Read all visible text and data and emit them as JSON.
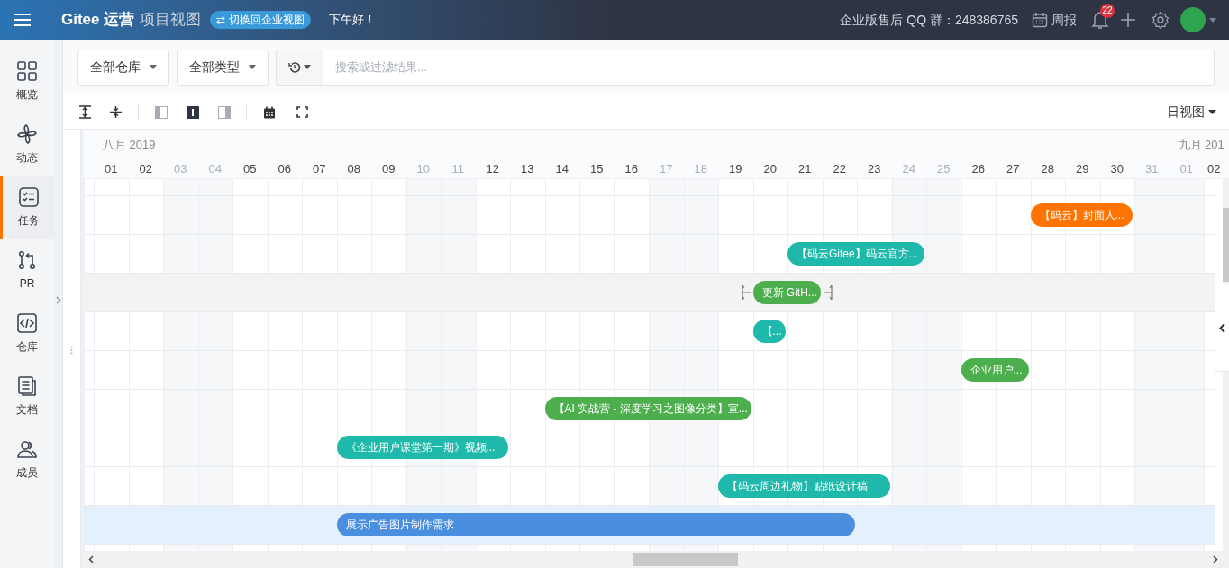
{
  "topbar": {
    "brand": "Gitee 运营",
    "view": "项目视图",
    "switch_label": "⇄ 切换回企业视图",
    "greeting": "下午好！",
    "support": "企业版售后 QQ 群：248386765",
    "report": "周报",
    "notification_count": "22"
  },
  "sidebar": {
    "items": [
      {
        "label": "概览",
        "kind": "overview",
        "selected": false
      },
      {
        "label": "动态",
        "kind": "activity",
        "selected": false
      },
      {
        "label": "任务",
        "kind": "task",
        "selected": true
      },
      {
        "label": "PR",
        "kind": "pr",
        "selected": false
      },
      {
        "label": "仓库",
        "kind": "repo",
        "selected": false
      },
      {
        "label": "文档",
        "kind": "doc",
        "selected": false
      },
      {
        "label": "成员",
        "kind": "member",
        "selected": false
      }
    ]
  },
  "filters": {
    "repo": "全部仓库",
    "type": "全部类型",
    "search_placeholder": "搜索或过滤结果..."
  },
  "toolbar": {
    "layouts": [
      {
        "selected": false
      },
      {
        "selected": true
      },
      {
        "selected": false
      }
    ],
    "view": "日视图"
  },
  "gantt": {
    "months": [
      {
        "label": "八月 2019"
      },
      {
        "label": "九月 201"
      }
    ],
    "days": [
      {
        "label": "01",
        "weekend": false
      },
      {
        "label": "02",
        "weekend": false
      },
      {
        "label": "03",
        "weekend": true
      },
      {
        "label": "04",
        "weekend": true
      },
      {
        "label": "05",
        "weekend": false
      },
      {
        "label": "06",
        "weekend": false
      },
      {
        "label": "07",
        "weekend": false
      },
      {
        "label": "08",
        "weekend": false
      },
      {
        "label": "09",
        "weekend": false
      },
      {
        "label": "10",
        "weekend": true
      },
      {
        "label": "11",
        "weekend": true
      },
      {
        "label": "12",
        "weekend": false
      },
      {
        "label": "13",
        "weekend": false
      },
      {
        "label": "14",
        "weekend": false
      },
      {
        "label": "15",
        "weekend": false
      },
      {
        "label": "16",
        "weekend": false
      },
      {
        "label": "17",
        "weekend": true
      },
      {
        "label": "18",
        "weekend": true
      },
      {
        "label": "19",
        "weekend": false
      },
      {
        "label": "20",
        "weekend": false
      },
      {
        "label": "21",
        "weekend": false
      },
      {
        "label": "22",
        "weekend": false
      },
      {
        "label": "23",
        "weekend": false
      },
      {
        "label": "24",
        "weekend": true
      },
      {
        "label": "25",
        "weekend": true
      },
      {
        "label": "26",
        "weekend": false
      },
      {
        "label": "27",
        "weekend": false
      },
      {
        "label": "28",
        "weekend": false
      },
      {
        "label": "29",
        "weekend": false
      },
      {
        "label": "30",
        "weekend": false
      },
      {
        "label": "31",
        "weekend": true
      },
      {
        "label": "01",
        "weekend": true
      },
      {
        "label": "02",
        "weekend": false
      }
    ],
    "rows": [
      {
        "selected": false,
        "hovered": false,
        "task": {
          "title": "【码云】封面人...",
          "color": "#ff7300"
        }
      },
      {
        "selected": false,
        "hovered": false,
        "task": {
          "title": "【码云Gitee】码云官方...",
          "color": "#1fb9ab"
        }
      },
      {
        "selected": false,
        "hovered": true,
        "task": {
          "title": "更新 GitH...",
          "color": "#4cae4c"
        }
      },
      {
        "selected": false,
        "hovered": false,
        "task": {
          "title": "【...",
          "color": "#1fb9ab"
        }
      },
      {
        "selected": false,
        "hovered": false,
        "task": {
          "title": "企业用户...",
          "color": "#4cae4c"
        }
      },
      {
        "selected": false,
        "hovered": false,
        "task": {
          "title": "【AI 实战营 - 深度学习之图像分类】宣...",
          "color": "#4cae4c"
        }
      },
      {
        "selected": false,
        "hovered": false,
        "task": {
          "title": "《企业用户课堂第一期》视频...",
          "color": "#1fb9ab"
        }
      },
      {
        "selected": false,
        "hovered": false,
        "task": {
          "title": "【码云周边礼物】贴纸设计稿",
          "color": "#1fb9ab"
        }
      },
      {
        "selected": true,
        "hovered": false,
        "task": {
          "title": "展示广告图片制作需求",
          "color": "#4a8fdf"
        }
      }
    ]
  }
}
